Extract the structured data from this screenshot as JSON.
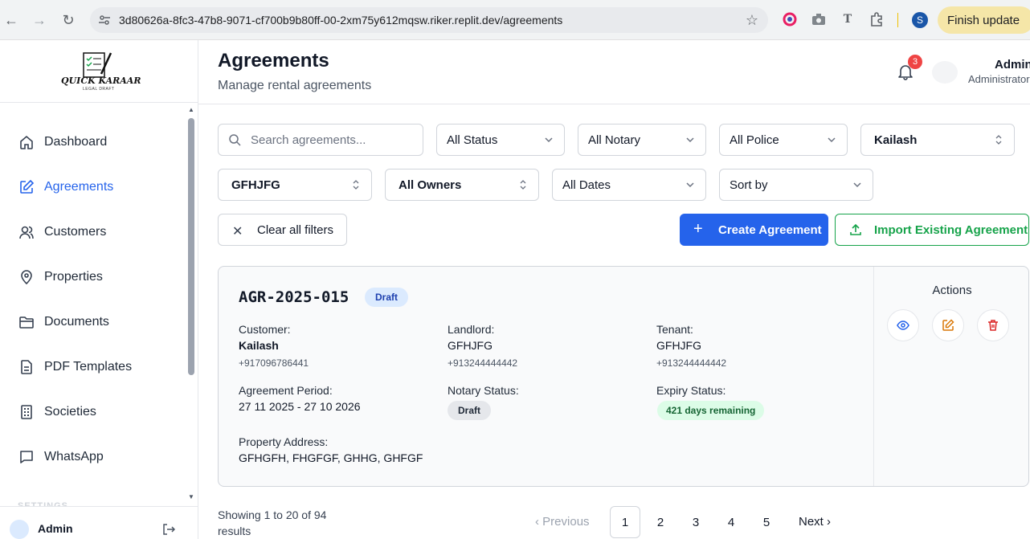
{
  "browser": {
    "url": "3d80626a-8fc3-47b8-9071-cf700b9b80ff-00-2xm75y612mqsw.riker.replit.dev/agreements",
    "finish_update_label": "Finish update",
    "profile_initial": "S"
  },
  "brand": {
    "logo_text": "QUICK KARAAR",
    "logo_subtext": "LEGAL DRAFT"
  },
  "sidebar": {
    "items": [
      {
        "label": "Dashboard",
        "icon": "home-icon"
      },
      {
        "label": "Agreements",
        "icon": "edit-document-icon",
        "active": true
      },
      {
        "label": "Customers",
        "icon": "users-icon"
      },
      {
        "label": "Properties",
        "icon": "map-pin-icon"
      },
      {
        "label": "Documents",
        "icon": "folder-icon"
      },
      {
        "label": "PDF Templates",
        "icon": "file-text-icon"
      },
      {
        "label": "Societies",
        "icon": "building-icon"
      },
      {
        "label": "WhatsApp",
        "icon": "message-icon"
      }
    ],
    "section_label": "SETTINGS",
    "footer_user": "Admin"
  },
  "header": {
    "title": "Agreements",
    "subtitle": "Manage rental agreements",
    "notification_count": "3",
    "user_name": "Admin",
    "user_role": "Administrator"
  },
  "filters": {
    "search_placeholder": "Search agreements...",
    "status": "All Status",
    "notary": "All Notary",
    "police": "All Police",
    "customer": "Kailash",
    "property": "GFHJFG",
    "owners": "All Owners",
    "dates": "All Dates",
    "sort": "Sort by",
    "clear_label": "Clear all filters",
    "create_label": "Create Agreement",
    "import_label": "Import Existing Agreement"
  },
  "agreement": {
    "id": "AGR-2025-015",
    "status": "Draft",
    "customer_label": "Customer:",
    "customer_name": "Kailash",
    "customer_phone": "+917096786441",
    "landlord_label": "Landlord:",
    "landlord_name": "GFHJFG",
    "landlord_phone": "+913244444442",
    "tenant_label": "Tenant:",
    "tenant_name": "GFHJFG",
    "tenant_phone": "+913244444442",
    "period_label": "Agreement Period:",
    "period_value": "27 11 2025 - 27 10 2026",
    "notary_label": "Notary Status:",
    "notary_value": "Draft",
    "expiry_label": "Expiry Status:",
    "expiry_value": "421 days remaining",
    "address_label": "Property Address:",
    "address_value": "GFHGFH, FHGFGF, GHHG, GHFGF",
    "actions_title": "Actions"
  },
  "pagination": {
    "showing_text": "Showing 1 to 20 of 94 results",
    "previous_label": "Previous",
    "pages": [
      "1",
      "2",
      "3",
      "4",
      "5"
    ],
    "current_page": "1",
    "next_label": "Next"
  },
  "colors": {
    "primary": "#2563eb",
    "success": "#16a34a",
    "danger": "#dc2626",
    "warning": "#d97706"
  }
}
